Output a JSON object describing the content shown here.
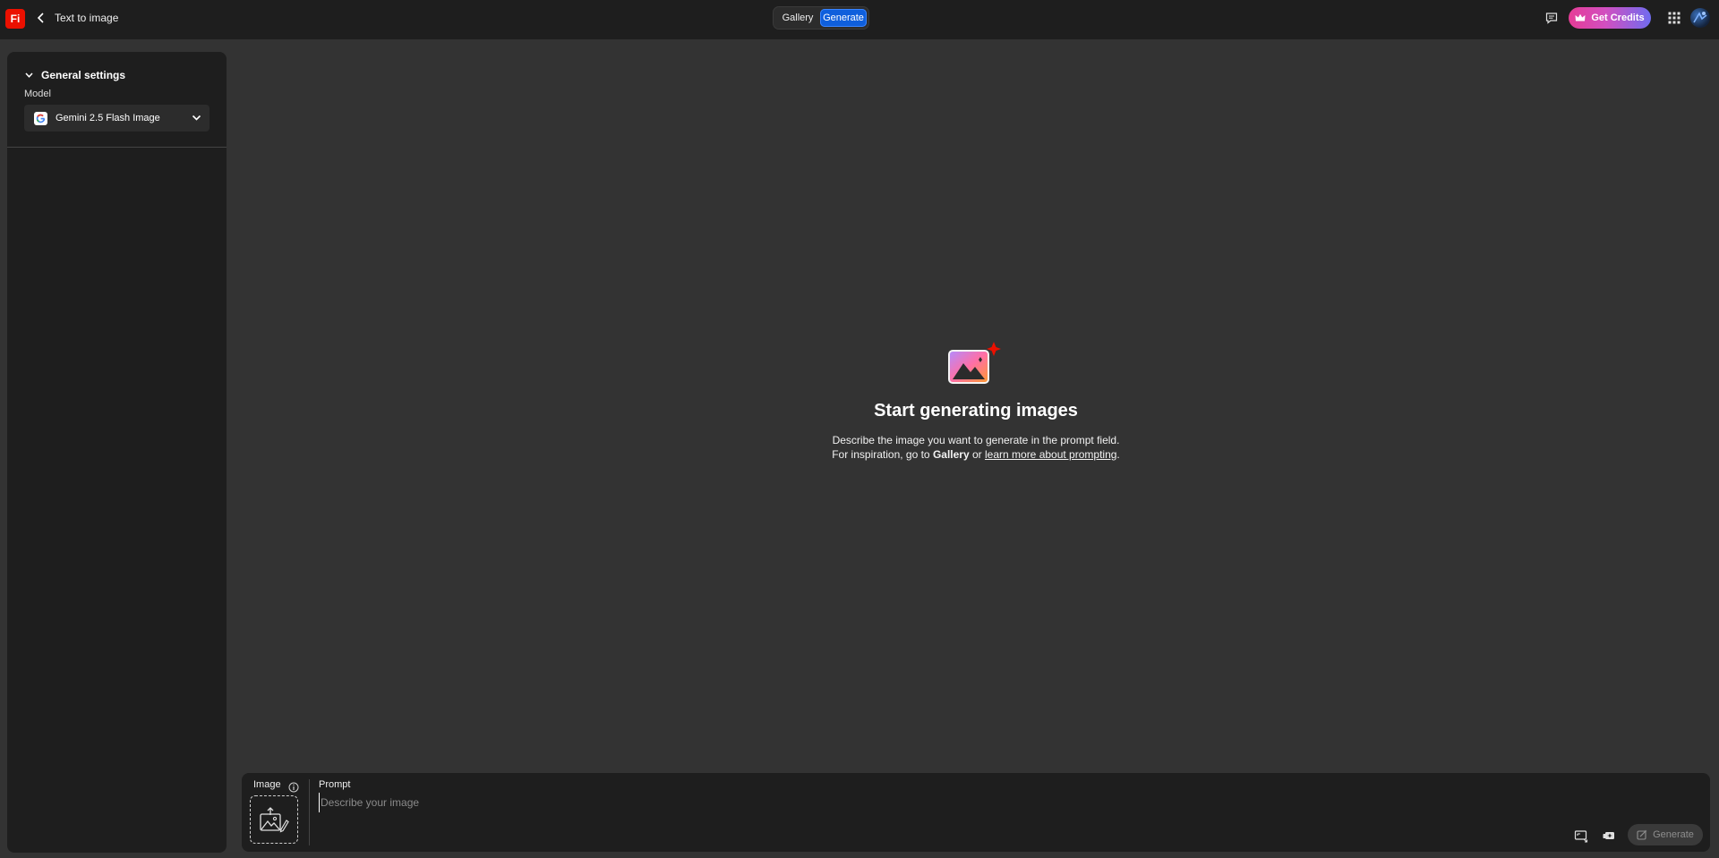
{
  "app": {
    "logo_text": "Fi",
    "page_title": "Text to image",
    "brand_color": "#eb1000"
  },
  "topbar": {
    "tabs": [
      {
        "label": "Gallery",
        "active": false
      },
      {
        "label": "Generate",
        "active": true
      }
    ],
    "get_credits_label": "Get Credits",
    "icons": [
      "chevron-left-icon",
      "feedback-icon",
      "crown-icon",
      "app-grid-icon"
    ]
  },
  "sidebar": {
    "section_title": "General settings",
    "model_label": "Model",
    "model_value": "Gemini 2.5 Flash Image"
  },
  "empty_state": {
    "title": "Start generating images",
    "line1": "Describe the image you want to generate in the prompt field.",
    "line2_prefix": "For inspiration, go to ",
    "gallery_link": "Gallery",
    "or_text": " or ",
    "learn_link": "learn more about prompting",
    "period": "."
  },
  "prompt_bar": {
    "image_label": "Image",
    "prompt_label": "Prompt",
    "prompt_placeholder": "Describe your image",
    "prompt_value": "",
    "generate_label": "Generate"
  },
  "colors": {
    "accent": "#0f5fdc",
    "background": "#333333",
    "panel": "#1e1e1e"
  }
}
